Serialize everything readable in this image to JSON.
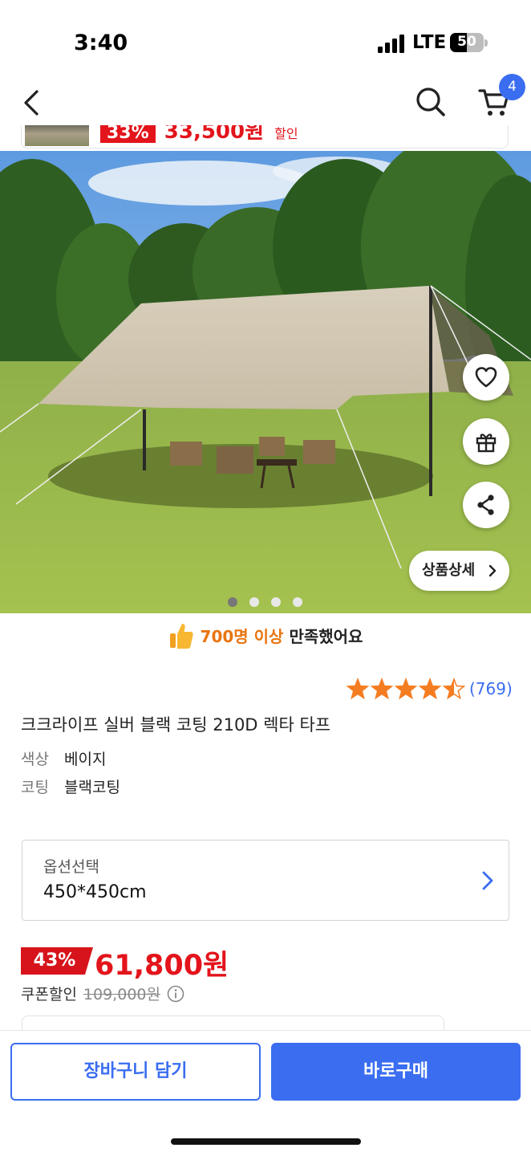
{
  "status_bar": {
    "time": "3:40",
    "network": "LTE",
    "battery": "50",
    "battery_level": 0.5
  },
  "header": {
    "back_icon": "chevron-left-icon",
    "search_icon": "search-icon",
    "cart_icon": "cart-icon",
    "cart_count": "4"
  },
  "mini_product": {
    "discount": "33%",
    "price": "33,500원",
    "suffix": "할인"
  },
  "hero": {
    "image_index": 1,
    "image_count": 4,
    "actions": [
      {
        "icon": "heart-icon"
      },
      {
        "icon": "gift-icon"
      },
      {
        "icon": "share-icon"
      }
    ],
    "detail_button": "상품상세"
  },
  "satisfaction": {
    "highlight": "700명 이상",
    "text": "만족했어요"
  },
  "rating": {
    "stars": 4.5,
    "count": "(769)"
  },
  "product": {
    "title": "크크라이프 실버 블랙 코팅 210D 렉타 타프",
    "attributes": [
      {
        "label": "색상",
        "value": "베이지"
      },
      {
        "label": "코팅",
        "value": "블랙코팅"
      }
    ]
  },
  "option": {
    "label": "옵션선택",
    "value": "450*450cm"
  },
  "price": {
    "discount": "43%",
    "sale": "61,800원",
    "coupon_label": "쿠폰할인",
    "original": "109,000원"
  },
  "actions": {
    "add_to_cart": "장바구니 담기",
    "buy_now": "바로구매"
  },
  "colors": {
    "accent": "#3a6df0",
    "sale": "#e3141b",
    "highlight": "#e9740f",
    "star": "#f47d22"
  }
}
